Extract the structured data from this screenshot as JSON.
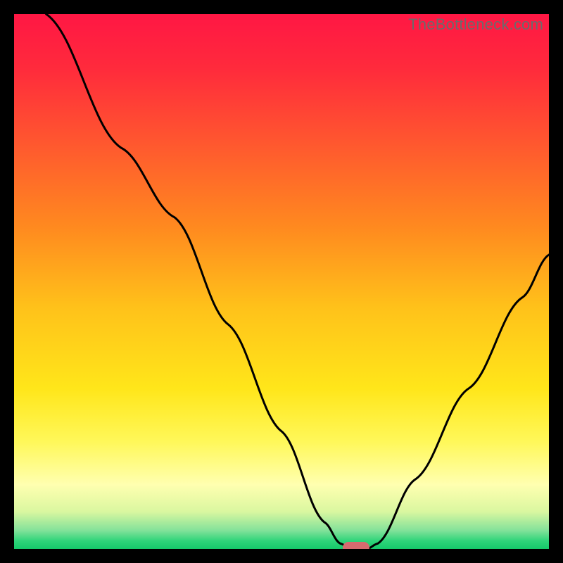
{
  "watermark": "TheBottleneck.com",
  "colors": {
    "frame": "#000000",
    "marker": "#d66a6f",
    "curve": "#000000",
    "gradient_stops": [
      {
        "offset": 0.0,
        "color": "#ff1744"
      },
      {
        "offset": 0.1,
        "color": "#ff2a3c"
      },
      {
        "offset": 0.25,
        "color": "#ff5a2e"
      },
      {
        "offset": 0.4,
        "color": "#ff8a1f"
      },
      {
        "offset": 0.55,
        "color": "#ffc21a"
      },
      {
        "offset": 0.7,
        "color": "#ffe61a"
      },
      {
        "offset": 0.8,
        "color": "#fff85a"
      },
      {
        "offset": 0.88,
        "color": "#ffffb0"
      },
      {
        "offset": 0.93,
        "color": "#daf7a0"
      },
      {
        "offset": 0.965,
        "color": "#84e29a"
      },
      {
        "offset": 0.985,
        "color": "#2fd47a"
      },
      {
        "offset": 1.0,
        "color": "#15c96a"
      }
    ]
  },
  "chart_data": {
    "type": "line",
    "title": "",
    "xlabel": "",
    "ylabel": "",
    "xlim": [
      0,
      100
    ],
    "ylim": [
      0,
      100
    ],
    "series": [
      {
        "name": "bottleneck-curve",
        "points": [
          {
            "x": 6,
            "y": 100
          },
          {
            "x": 20,
            "y": 75
          },
          {
            "x": 30,
            "y": 62
          },
          {
            "x": 40,
            "y": 42
          },
          {
            "x": 50,
            "y": 22
          },
          {
            "x": 58,
            "y": 5
          },
          {
            "x": 61,
            "y": 1
          },
          {
            "x": 63,
            "y": 0
          },
          {
            "x": 66,
            "y": 0
          },
          {
            "x": 68,
            "y": 1
          },
          {
            "x": 75,
            "y": 13
          },
          {
            "x": 85,
            "y": 30
          },
          {
            "x": 95,
            "y": 47
          },
          {
            "x": 100,
            "y": 55
          }
        ]
      }
    ],
    "marker": {
      "x_center": 64,
      "width_pct": 5,
      "y": 0
    }
  }
}
